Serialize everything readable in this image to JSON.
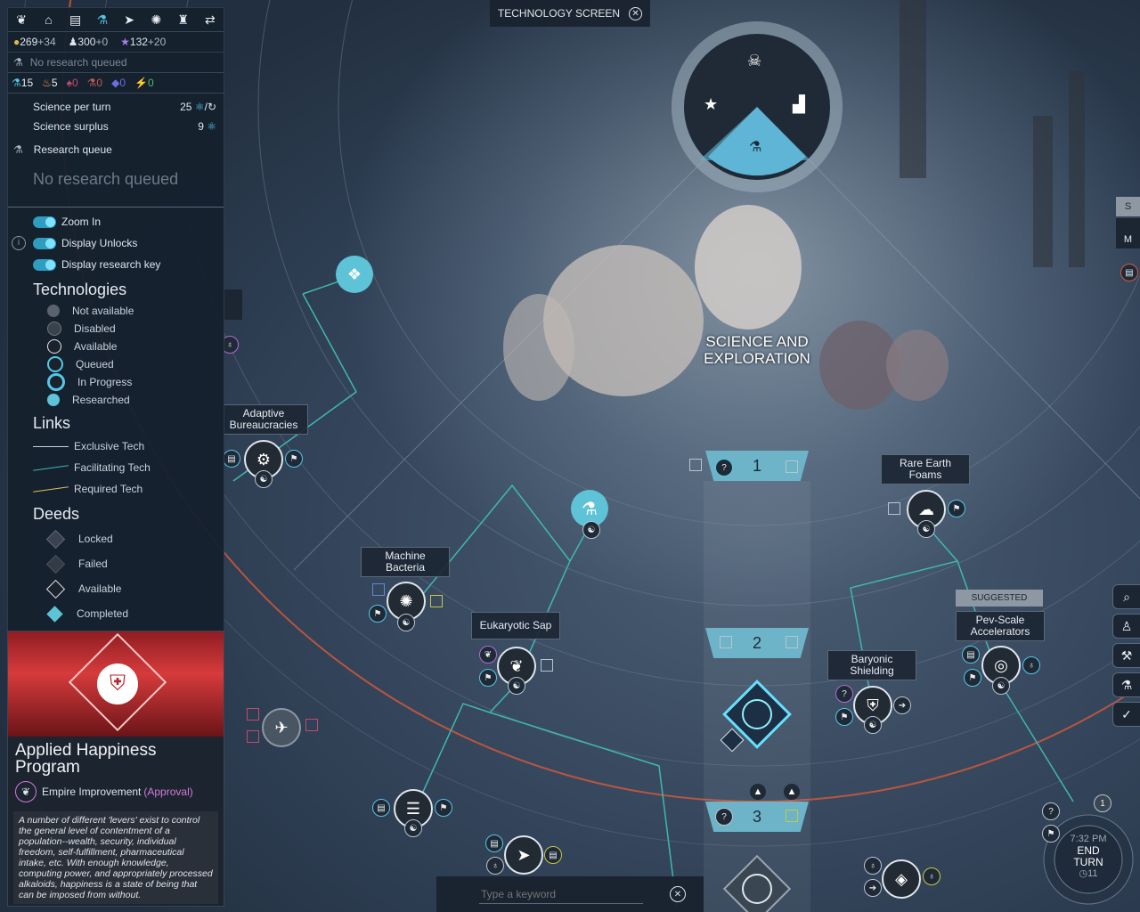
{
  "screen_title": "TECHNOLOGY SCREEN",
  "resources": {
    "money": "269",
    "money_delta": "+34",
    "influence": "300",
    "influence_delta": "+0",
    "research": "132",
    "research_delta": "+20"
  },
  "queue_status_short": "No research queued",
  "counts": [
    {
      "value": "15",
      "color": "#53c7e8"
    },
    {
      "value": "5",
      "color": "#f0a33a"
    },
    {
      "value": "0",
      "color": "#c04c6a"
    },
    {
      "value": "0",
      "color": "#c05a5a"
    },
    {
      "value": "0",
      "color": "#6a6ee0"
    },
    {
      "value": "0",
      "color": "#4fb86a"
    }
  ],
  "science": {
    "per_turn_label": "Science per turn",
    "per_turn_value": "25",
    "per_turn_unit": "/",
    "surplus_label": "Science surplus",
    "surplus_value": "9"
  },
  "research_queue": {
    "title": "Research queue",
    "empty": "No research queued"
  },
  "toggles": [
    {
      "label": "Zoom In"
    },
    {
      "label": "Display Unlocks"
    },
    {
      "label": "Display research key"
    }
  ],
  "legend": {
    "technologies_title": "Technologies",
    "technologies": [
      "Not available",
      "Disabled",
      "Available",
      "Queued",
      "In Progress",
      "Researched"
    ],
    "links_title": "Links",
    "links": [
      "Exclusive Tech",
      "Facilitating Tech",
      "Required Tech"
    ],
    "deeds_title": "Deeds",
    "deeds": [
      "Locked",
      "Failed",
      "Available",
      "Completed"
    ]
  },
  "selected": {
    "title": "Applied Happiness Program",
    "category": "Empire Improvement",
    "category_suffix": "(Approval)",
    "description": "A number of different 'levers' exist to control the general level of contentment of a population--wealth, security, individual freedom, self-fulfillment, pharmaceutical intake, etc. With enough knowledge, computing power, and appropriately processed alkaloids, happiness is a state of being that can be imposed from without."
  },
  "era_title": "SCIENCE AND EXPLORATION",
  "tiers": [
    "1",
    "2",
    "3"
  ],
  "techs": {
    "adaptive": "Adaptive Bureaucracies",
    "machine": "Machine Bacteria",
    "eukaryotic": "Eukaryotic Sap",
    "rare_earth": "Rare Earth Foams",
    "baryonic": "Baryonic Shielding",
    "pev_scale": "Pev-Scale Accelerators",
    "suggested": "SUGGESTED"
  },
  "search": {
    "placeholder": "Type a keyword"
  },
  "turn": {
    "time": "7:32 PM",
    "line1": "END",
    "line2": "TURN",
    "turns": "11",
    "queue_count": "1"
  },
  "right_partial": {
    "a": "S",
    "b": "M"
  },
  "colors": {
    "accent": "#53c7e8",
    "tier_box": "#6db4c8",
    "approval": "#d57ad9",
    "era_border": "#d0583a"
  }
}
